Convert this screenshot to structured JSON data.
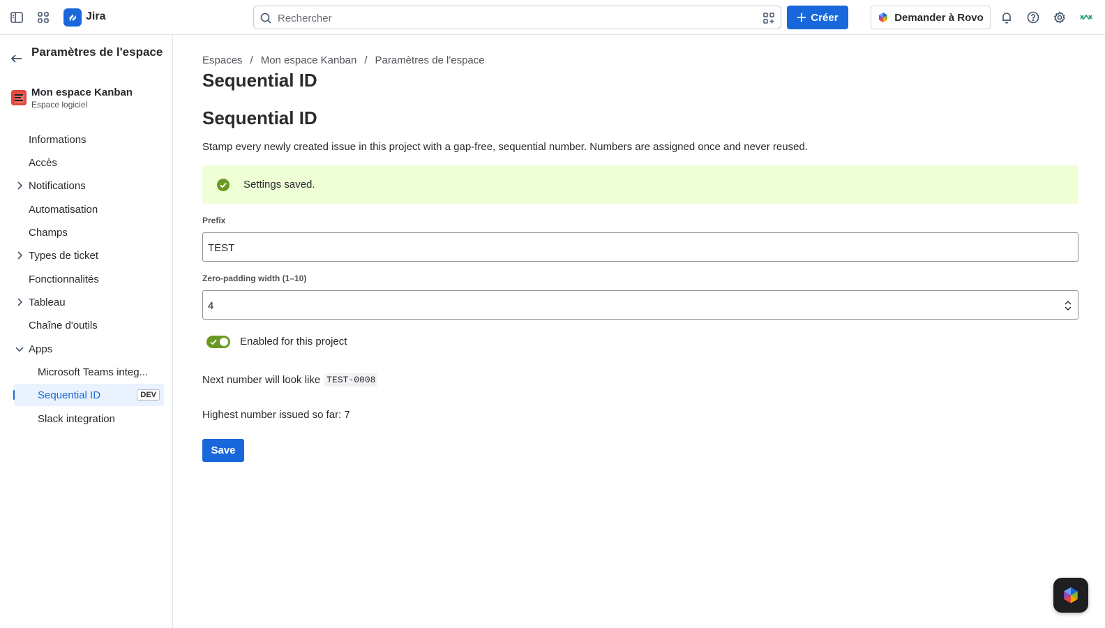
{
  "topbar": {
    "app_name": "Jira",
    "search_placeholder": "Rechercher",
    "create_label": "Créer",
    "rovo_label": "Demander à Rovo"
  },
  "sidebar": {
    "title": "Paramètres de l'espace",
    "project_name": "Mon espace Kanban",
    "project_type": "Espace logiciel",
    "items": [
      {
        "label": "Informations"
      },
      {
        "label": "Accès"
      },
      {
        "label": "Notifications"
      },
      {
        "label": "Automatisation"
      },
      {
        "label": "Champs"
      },
      {
        "label": "Types de ticket"
      },
      {
        "label": "Fonctionnalités"
      },
      {
        "label": "Tableau"
      },
      {
        "label": "Chaîne d'outils"
      },
      {
        "label": "Apps"
      }
    ],
    "apps": [
      {
        "label": "Microsoft Teams integ..."
      },
      {
        "label": "Sequential ID",
        "badge": "DEV"
      },
      {
        "label": "Slack integration"
      }
    ]
  },
  "breadcrumb": [
    "Espaces",
    "Mon espace Kanban",
    "Paramètres de l'espace"
  ],
  "main": {
    "page_title": "Sequential ID",
    "section_title": "Sequential ID",
    "description": "Stamp every newly created issue in this project with a gap-free, sequential number. Numbers are assigned once and never reused.",
    "success_message": "Settings saved.",
    "prefix_label": "Prefix",
    "prefix_value": "TEST",
    "padding_label": "Zero-padding width (1–10)",
    "padding_value": "4",
    "toggle_label": "Enabled for this project",
    "next_number_text": "Next number will look like",
    "next_number_example": "TEST-0008",
    "highest_text": "Highest number issued so far: 7",
    "save_label": "Save"
  },
  "colors": {
    "accent": "#1868db",
    "success_bg": "#efffd6",
    "toggle_on": "#6a9a23"
  }
}
